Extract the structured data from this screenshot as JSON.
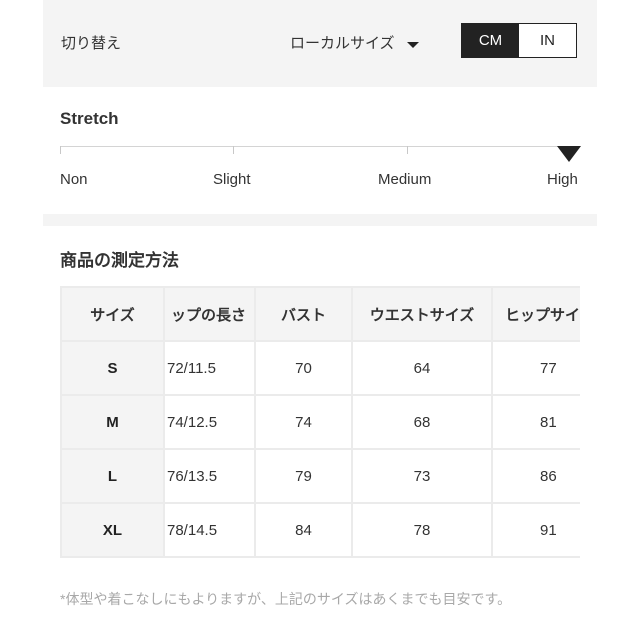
{
  "switch_bar": {
    "label": "切り替え",
    "size_system": "ローカルサイズ",
    "units": [
      {
        "label": "CM",
        "active": true
      },
      {
        "label": "IN",
        "active": false
      }
    ]
  },
  "stretch": {
    "title": "Stretch",
    "levels": [
      "Non",
      "Slight",
      "Medium",
      "High"
    ],
    "selected": "High"
  },
  "measurement": {
    "title": "商品の測定方法",
    "headers": [
      "サイズ",
      "トップの長さ",
      "バスト",
      "ウエストサイズ",
      "ヒップサイズ"
    ],
    "visible_headers": [
      "サイズ",
      "ップの長さ",
      "バスト",
      "ウエストサイズ",
      "ヒップサイ"
    ],
    "rows": [
      {
        "size": "S",
        "values": [
          "72/11.5",
          "70",
          "64",
          "77"
        ]
      },
      {
        "size": "M",
        "values": [
          "74/12.5",
          "74",
          "68",
          "81"
        ]
      },
      {
        "size": "L",
        "values": [
          "76/13.5",
          "79",
          "73",
          "86"
        ]
      },
      {
        "size": "XL",
        "values": [
          "78/14.5",
          "84",
          "78",
          "91"
        ]
      }
    ]
  },
  "note": "*体型や着こなしにもよりますが、上記のサイズはあくまでも目安です。"
}
